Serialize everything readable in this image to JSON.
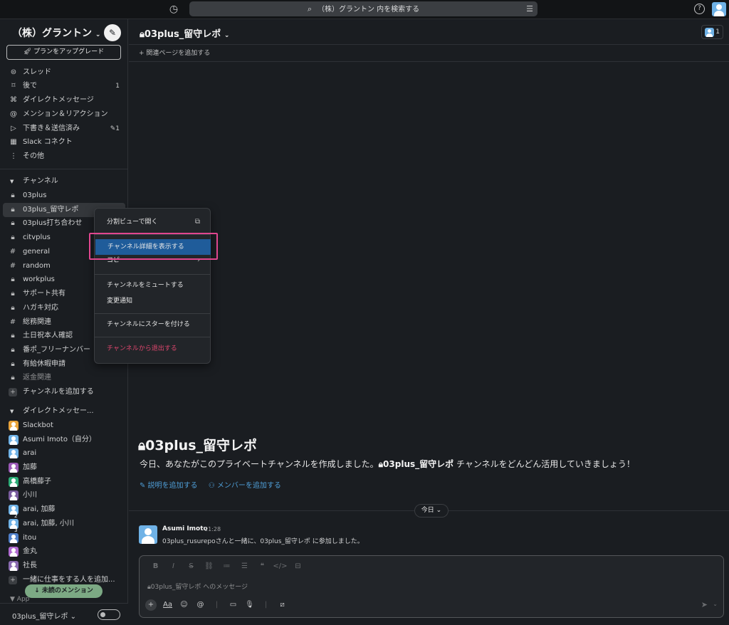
{
  "topbar": {
    "search_text": "（株）グラントン 内を検索する"
  },
  "sidebar": {
    "workspace_name": "（株）グラントン",
    "upgrade_label": "プランをアップグレード",
    "nav": [
      {
        "label": "スレッド",
        "icon": "threads-icon",
        "count": ""
      },
      {
        "label": "後で",
        "icon": "bookmark-icon",
        "count": "1"
      },
      {
        "label": "ダイレクトメッセージ",
        "icon": "dm-icon",
        "count": ""
      },
      {
        "label": "メンション＆リアクション",
        "icon": "at-icon",
        "count": ""
      },
      {
        "label": "下書き＆送信済み",
        "icon": "send-icon",
        "count": "1"
      },
      {
        "label": "Slack コネクト",
        "icon": "building-icon",
        "count": ""
      },
      {
        "label": "その他",
        "icon": "more-icon",
        "count": ""
      }
    ],
    "channels_header": "チャンネル",
    "channels": [
      {
        "label": "03plus",
        "type": "private"
      },
      {
        "label": "03plus_留守レポ",
        "type": "private"
      },
      {
        "label": "03plus打ち合わせ",
        "type": "private"
      },
      {
        "label": "citvplus",
        "type": "private"
      },
      {
        "label": "general",
        "type": "public"
      },
      {
        "label": "random",
        "type": "public"
      },
      {
        "label": "workplus",
        "type": "private"
      },
      {
        "label": "サポート共有",
        "type": "private"
      },
      {
        "label": "ハガキ対応",
        "type": "private"
      },
      {
        "label": "総務関連",
        "type": "public"
      },
      {
        "label": "土日祝本人確認",
        "type": "private"
      },
      {
        "label": "番ポ_フリーナンバー",
        "type": "private"
      },
      {
        "label": "有給休暇申請",
        "type": "private"
      },
      {
        "label": "返金関連",
        "type": "private"
      }
    ],
    "add_channel_label": "チャンネルを追加する",
    "dm_header": "ダイレクトメッセー...",
    "dms": [
      {
        "label": "Slackbot",
        "color": "#e8a33b",
        "num": ""
      },
      {
        "label": "Asumi Imoto（自分）",
        "color": "#6fb2e6",
        "num": ""
      },
      {
        "label": "arai",
        "color": "#6fb2e6",
        "num": ""
      },
      {
        "label": "加藤",
        "color": "#9b59b6",
        "num": ""
      },
      {
        "label": "高橋藤子",
        "color": "#2bac76",
        "num": ""
      },
      {
        "label": "小川",
        "color": "#7a5c9e",
        "num": ""
      },
      {
        "label": "arai, 加藤",
        "color": "#6fb2e6",
        "num": "2"
      },
      {
        "label": "arai, 加藤, 小川",
        "color": "#6fb2e6",
        "num": "3"
      },
      {
        "label": "itou",
        "color": "#4f7fc9",
        "num": ""
      },
      {
        "label": "金丸",
        "color": "#b06ad1",
        "num": ""
      },
      {
        "label": "社長",
        "color": "#8a6bb0",
        "num": ""
      }
    ],
    "invite_label": "一緒に仕事をする人を追加...",
    "mention_pill": "↓ 未読のメンション",
    "app_peek": "App",
    "current_channel": "03plus_留守レポ ⌄"
  },
  "main": {
    "channel_title": "03plus_留守レポ",
    "members_count": "1",
    "bookmark_label": "+ 関連ページを追加する",
    "intro_title": "03plus_留守レポ",
    "intro_desc_prefix": "今日、あなたがこのプライベートチャンネルを作成しました。",
    "intro_desc_channel": "03plus_留守レポ",
    "intro_desc_suffix": " チャンネルをどんどん活用していきましょう！",
    "link_description": "✎ 説明を追加する",
    "link_members": "⚇ メンバーを追加する",
    "date_pill": "今日 ⌄",
    "message": {
      "author": "Asumi Imoto",
      "time": "11:28",
      "text": "03plus_rusurepoさんと一緒に、03plus_留守レポ に参加しました。"
    },
    "composer_placeholder": "03plus_留守レポ へのメッセージ"
  },
  "context_menu": {
    "split_view": "分割ビューで開く",
    "view_details": "チャンネル詳細を表示する",
    "copy": "コピー",
    "mute": "チャンネルをミュートする",
    "notify": "変更通知",
    "star": "チャンネルにスターを付ける",
    "leave": "チャンネルから退出する"
  },
  "colors": {
    "background": "#1a1d21",
    "highlight": "#1f5c9a",
    "danger": "#e0466e",
    "annotation": "#e0468f",
    "link": "#4f9ed7"
  }
}
